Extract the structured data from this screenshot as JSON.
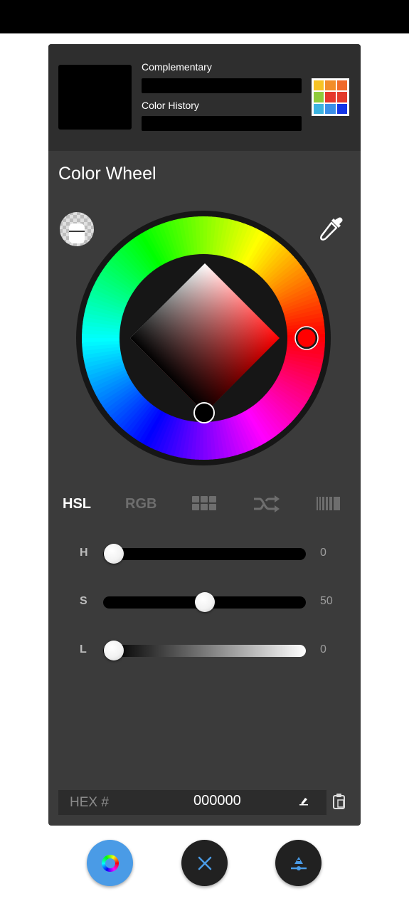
{
  "header": {
    "complementary_label": "Complementary",
    "history_label": "Color History",
    "current_color": "#000000",
    "palette_colors": [
      "#f7c325",
      "#f28d2a",
      "#f06a2a",
      "#8fcb3a",
      "#e6372b",
      "#e33a2a",
      "#3cb4e0",
      "#3b8fe8",
      "#1436e6"
    ]
  },
  "wheel": {
    "title": "Color Wheel",
    "hue_marker_color": "#ff0000"
  },
  "tabs": {
    "hsl": "HSL",
    "rgb": "RGB",
    "swatches_icon": "grid-icon",
    "shuffle_icon": "shuffle-icon",
    "gradient_icon": "stripes-icon",
    "active": "HSL"
  },
  "sliders": {
    "h": {
      "label": "H",
      "value": "0",
      "fraction": 0
    },
    "s": {
      "label": "S",
      "value": "50",
      "fraction": 0.5
    },
    "l": {
      "label": "L",
      "value": "0",
      "fraction": 0
    }
  },
  "hex": {
    "label": "HEX #",
    "value": "000000"
  },
  "colors": {
    "accent": "#4a9be6",
    "panel": "#3b3b3b"
  }
}
